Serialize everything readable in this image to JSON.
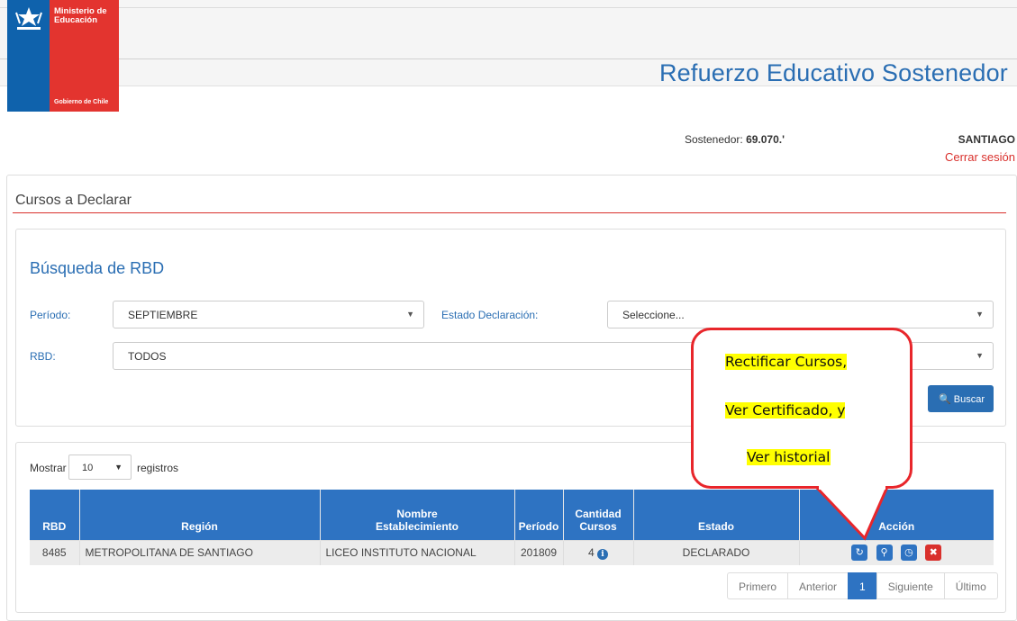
{
  "header": {
    "logo_line1": "Ministerio de Educación",
    "logo_line2": "Gobierno de Chile",
    "app_title": "Refuerzo Educativo Sostenedor"
  },
  "user": {
    "sostenedor_label": "Sostenedor:",
    "sostenedor_value": "69.070.'",
    "city": "SANTIAGO",
    "logout": "Cerrar sesión"
  },
  "page": {
    "title": "Cursos a Declarar"
  },
  "search": {
    "title": "Búsqueda de RBD",
    "periodo_label": "Período:",
    "periodo_value": "SEPTIEMBRE",
    "estado_label": "Estado Declaración:",
    "estado_value": "Seleccione...",
    "rbd_label": "RBD:",
    "rbd_value": "TODOS",
    "button": "Buscar"
  },
  "results": {
    "show_label": "Mostrar",
    "page_length": "10",
    "records_label": "registros",
    "columns": [
      "RBD",
      "Región",
      "Nombre Establecimiento",
      "Período",
      "Cantidad Cursos",
      "Estado",
      "Acción"
    ],
    "rows": [
      {
        "rbd": "8485",
        "region": "METROPOLITANA DE SANTIAGO",
        "establecimiento": "LICEO INSTITUTO NACIONAL",
        "periodo": "201809",
        "cursos": "4",
        "estado": "DECLARADO"
      }
    ]
  },
  "pagination": {
    "first": "Primero",
    "prev": "Anterior",
    "current": "1",
    "next": "Siguiente",
    "last": "Último"
  },
  "callout": {
    "line1": "Rectificar Cursos,",
    "line2": "Ver Certificado, y",
    "line3": "Ver historial"
  },
  "colors": {
    "brand_blue": "#2e73c2",
    "brand_red": "#d9302c",
    "highlight": "#ffff00"
  }
}
